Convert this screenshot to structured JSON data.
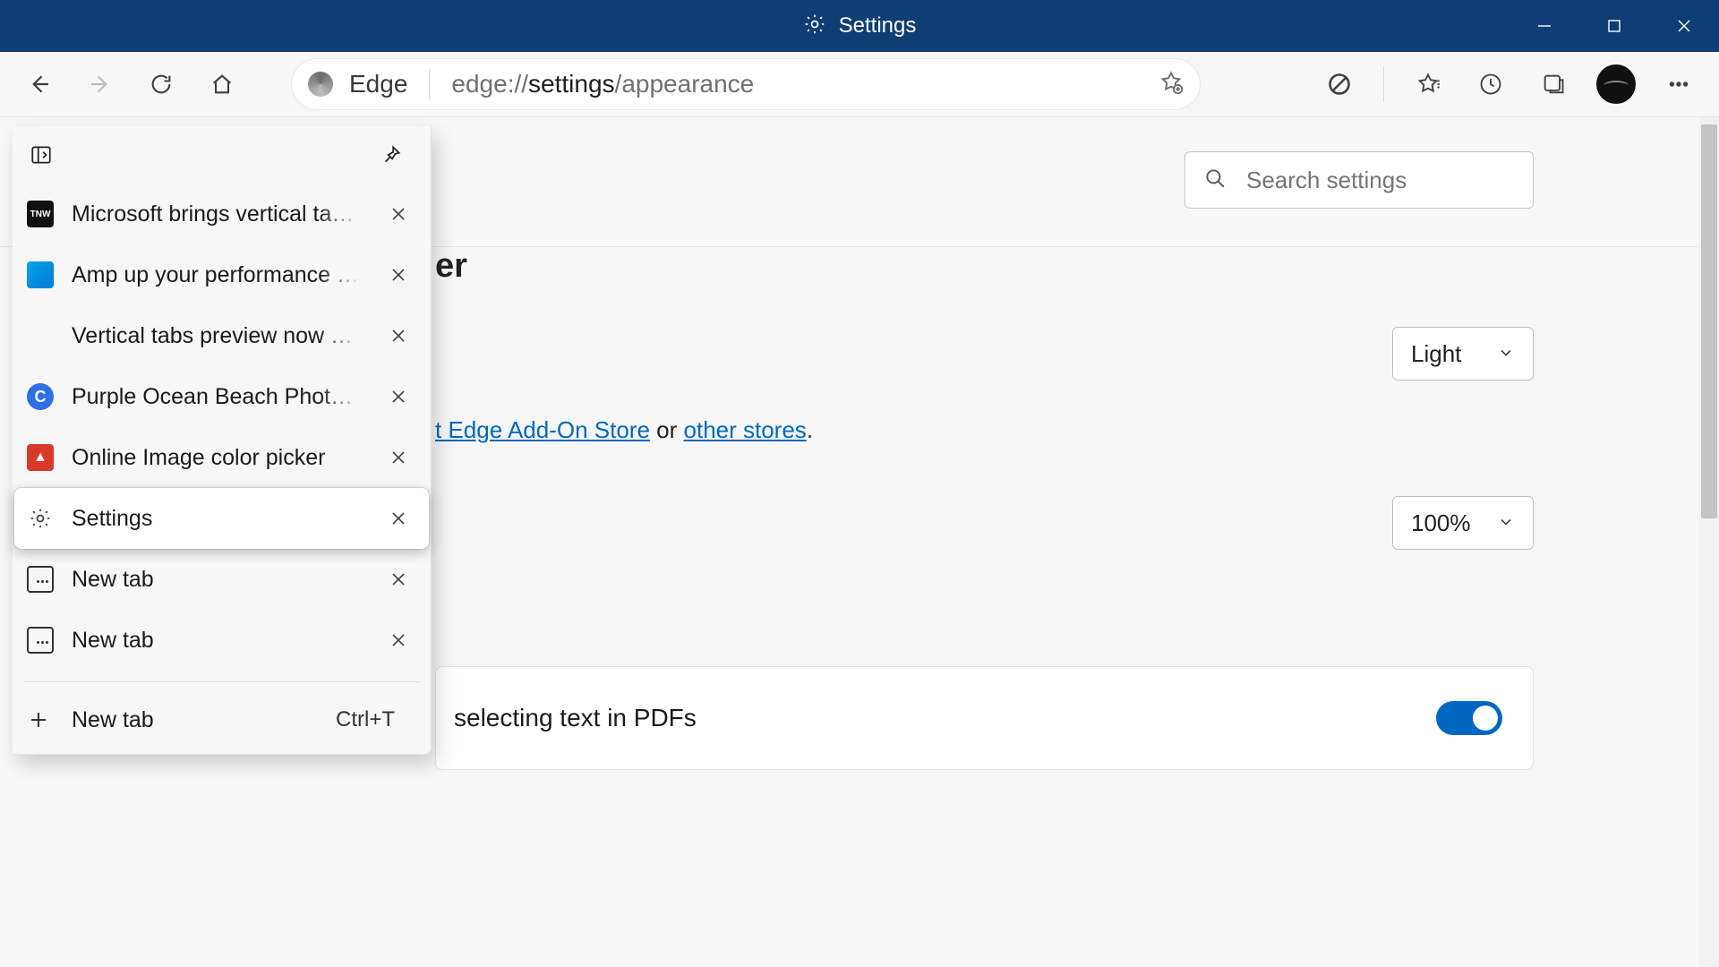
{
  "window": {
    "title": "Settings"
  },
  "toolbar": {
    "address": {
      "label": "Edge",
      "url_prefix": "edge://",
      "url_strong": "settings",
      "url_suffix": "/appearance"
    }
  },
  "search": {
    "placeholder": "Search settings"
  },
  "page": {
    "heading_fragment": "er",
    "theme_select": "Light",
    "addon_line": {
      "link1": "t Edge Add-On Store",
      "mid": " or ",
      "link2": "other stores",
      "end": "."
    },
    "zoom_select": "100%",
    "card_text": "selecting text in PDFs"
  },
  "tabs": {
    "items": [
      {
        "title": "Microsoft brings vertical tabs to E",
        "fav": "tnw",
        "favtext": "TNW"
      },
      {
        "title": "Amp up your performance with S",
        "fav": "win"
      },
      {
        "title": "Vertical tabs preview now availab",
        "fav": "ms"
      },
      {
        "title": "Purple Ocean Beach Photo Summ",
        "fav": "canva",
        "favtext": "C"
      },
      {
        "title": "Online Image color picker",
        "fav": "tree",
        "favtext": "▲"
      },
      {
        "title": "Settings",
        "fav": "gear",
        "active": true
      },
      {
        "title": "New tab",
        "fav": "nt"
      },
      {
        "title": "New tab",
        "fav": "nt"
      }
    ],
    "newtab_label": "New tab",
    "newtab_shortcut": "Ctrl+T"
  }
}
